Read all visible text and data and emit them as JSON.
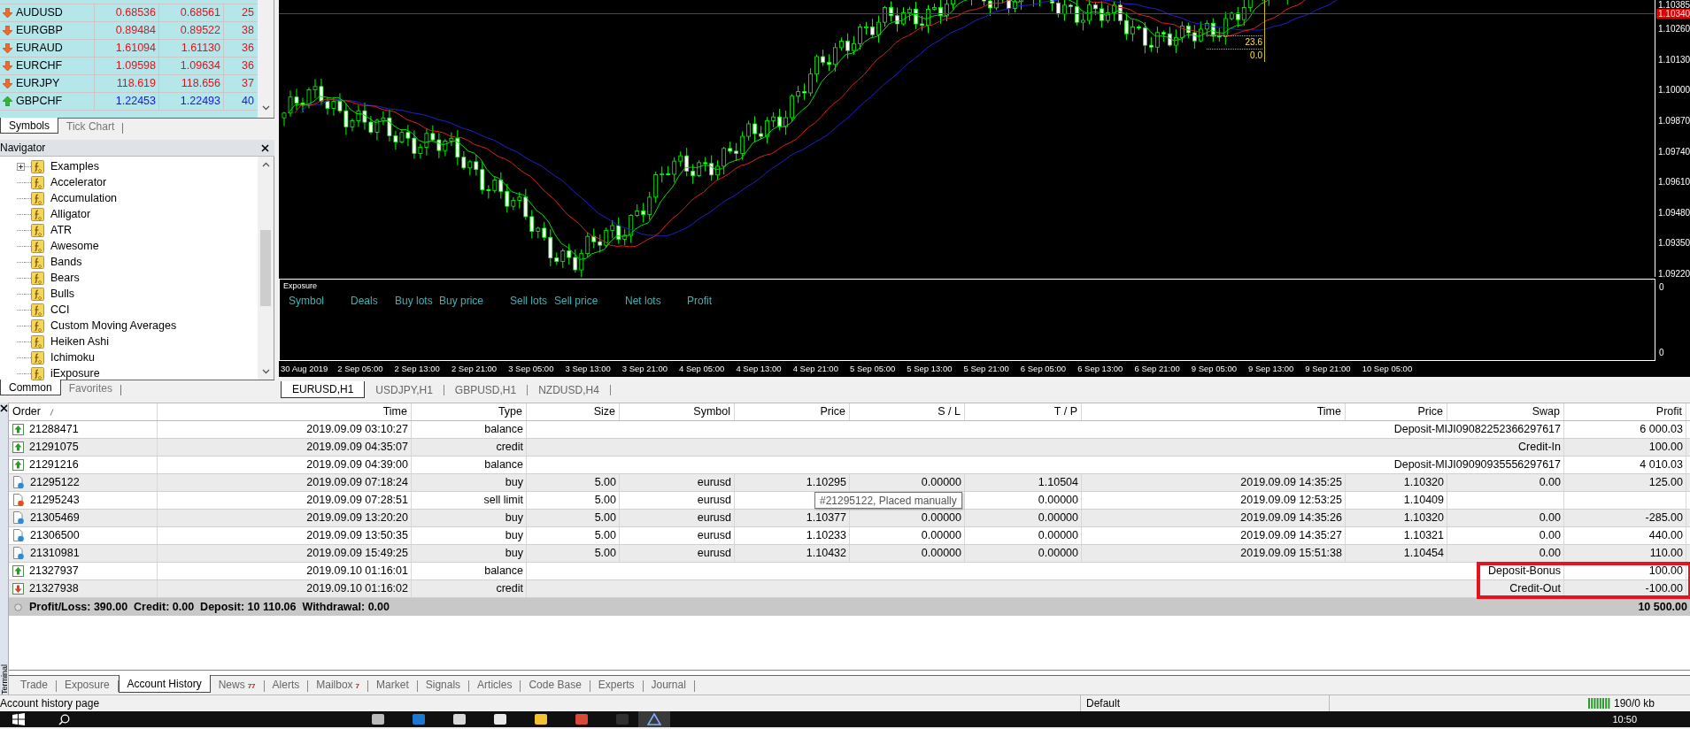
{
  "market_watch": {
    "rows": [
      {
        "symbol": "AUDUSD",
        "bid": "0.68536",
        "ask": "0.68561",
        "spread": "25",
        "rising": false
      },
      {
        "symbol": "EURGBP",
        "bid": "0.89484",
        "ask": "0.89522",
        "spread": "38",
        "rising": false
      },
      {
        "symbol": "EURAUD",
        "bid": "1.61094",
        "ask": "1.61130",
        "spread": "36",
        "rising": false
      },
      {
        "symbol": "EURCHF",
        "bid": "1.09598",
        "ask": "1.09634",
        "spread": "36",
        "rising": false
      },
      {
        "symbol": "EURJPY",
        "bid": "118.619",
        "ask": "118.656",
        "spread": "37",
        "rising": false
      },
      {
        "symbol": "GBPCHF",
        "bid": "1.22453",
        "ask": "1.22493",
        "spread": "40",
        "rising": true
      }
    ],
    "tabs": [
      {
        "label": "Symbols",
        "selected": true
      },
      {
        "label": "Tick Chart",
        "selected": false
      }
    ]
  },
  "navigator": {
    "title": "Navigator",
    "items": [
      {
        "label": "Examples",
        "expandable": true
      },
      {
        "label": "Accelerator",
        "expandable": false
      },
      {
        "label": "Accumulation",
        "expandable": false
      },
      {
        "label": "Alligator",
        "expandable": false
      },
      {
        "label": "ATR",
        "expandable": false
      },
      {
        "label": "Awesome",
        "expandable": false
      },
      {
        "label": "Bands",
        "expandable": false
      },
      {
        "label": "Bears",
        "expandable": false
      },
      {
        "label": "Bulls",
        "expandable": false
      },
      {
        "label": "CCI",
        "expandable": false
      },
      {
        "label": "Custom Moving Averages",
        "expandable": false
      },
      {
        "label": "Heiken Ashi",
        "expandable": false
      },
      {
        "label": "Ichimoku",
        "expandable": false
      },
      {
        "label": "iExposure",
        "expandable": false
      }
    ],
    "tabs": [
      {
        "label": "Common",
        "selected": true
      },
      {
        "label": "Favorites",
        "selected": false
      }
    ]
  },
  "chart": {
    "price_labels": [
      "1.10385",
      "1.10260",
      "1.10130",
      "1.10000",
      "1.09870",
      "1.09740",
      "1.09610",
      "1.09480",
      "1.09350",
      "1.09220"
    ],
    "current_price": "1.10340",
    "fib_labels": [
      "23.6",
      "0.0"
    ],
    "indicator": {
      "title": "Exposure",
      "columns": [
        "Symbol",
        "Deals",
        "Buy lots",
        "Buy price",
        "Sell lots",
        "Sell price",
        "Net lots",
        "Profit"
      ],
      "scale_labels": [
        "0",
        "0"
      ]
    },
    "time_labels": [
      "30 Aug 2019",
      "2 Sep 05:00",
      "2 Sep 13:00",
      "2 Sep 21:00",
      "3 Sep 05:00",
      "3 Sep 13:00",
      "3 Sep 21:00",
      "4 Sep 05:00",
      "4 Sep 13:00",
      "4 Sep 21:00",
      "5 Sep 05:00",
      "5 Sep 13:00",
      "5 Sep 21:00",
      "6 Sep 05:00",
      "6 Sep 13:00",
      "6 Sep 21:00",
      "9 Sep 05:00",
      "9 Sep 13:00",
      "9 Sep 21:00",
      "10 Sep 05:00"
    ],
    "tabs": [
      {
        "label": "EURUSD,H1",
        "selected": true
      },
      {
        "label": "USDJPY,H1",
        "selected": false
      },
      {
        "label": "GBPUSD,H1",
        "selected": false
      },
      {
        "label": "NZDUSD,H4",
        "selected": false
      }
    ]
  },
  "terminal": {
    "title": "Terminal",
    "columns": [
      "Order",
      "Time",
      "Type",
      "Size",
      "Symbol",
      "Price",
      "S / L",
      "T / P",
      "Time",
      "Price",
      "Swap",
      "Profit"
    ],
    "rows": [
      {
        "kind": "balance",
        "outflow": false,
        "order": "21288471",
        "time": "2019.09.09 03:10:27",
        "type": "balance",
        "comment": "Deposit-MIJI09082252366297617",
        "profit": "6 000.03"
      },
      {
        "kind": "balance",
        "outflow": false,
        "order": "21291075",
        "time": "2019.09.09 04:35:07",
        "type": "credit",
        "comment": "Credit-In",
        "profit": "100.00"
      },
      {
        "kind": "balance",
        "outflow": false,
        "order": "21291216",
        "time": "2019.09.09 04:39:00",
        "type": "balance",
        "comment": "Deposit-MIJI09090935556297617",
        "profit": "4 010.03"
      },
      {
        "kind": "trade",
        "pending": false,
        "order": "21295122",
        "time": "2019.09.09 07:18:24",
        "type": "buy",
        "size": "5.00",
        "symbol": "eurusd",
        "price": "1.10295",
        "sl": "0.00000",
        "tp": "1.10504",
        "close_time": "2019.09.09 14:35:25",
        "close_price": "1.10320",
        "swap": "0.00",
        "profit": "125.00"
      },
      {
        "kind": "trade",
        "pending": true,
        "order": "21295243",
        "time": "2019.09.09 07:28:51",
        "type": "sell limit",
        "size": "5.00",
        "symbol": "eurusd",
        "tp": "0.00000",
        "close_time": "2019.09.09 12:53:25",
        "close_price": "1.10409"
      },
      {
        "kind": "trade",
        "pending": false,
        "order": "21305469",
        "time": "2019.09.09 13:20:20",
        "type": "buy",
        "size": "5.00",
        "symbol": "eurusd",
        "price": "1.10377",
        "sl": "0.00000",
        "tp": "0.00000",
        "close_time": "2019.09.09 14:35:26",
        "close_price": "1.10320",
        "swap": "0.00",
        "profit": "-285.00"
      },
      {
        "kind": "trade",
        "pending": false,
        "order": "21306500",
        "time": "2019.09.09 13:50:35",
        "type": "buy",
        "size": "5.00",
        "symbol": "eurusd",
        "price": "1.10233",
        "sl": "0.00000",
        "tp": "0.00000",
        "close_time": "2019.09.09 14:35:27",
        "close_price": "1.10321",
        "swap": "0.00",
        "profit": "440.00"
      },
      {
        "kind": "trade",
        "pending": false,
        "order": "21310981",
        "time": "2019.09.09 15:49:25",
        "type": "buy",
        "size": "5.00",
        "symbol": "eurusd",
        "price": "1.10432",
        "sl": "0.00000",
        "tp": "0.00000",
        "close_time": "2019.09.09 15:51:38",
        "close_price": "1.10454",
        "swap": "0.00",
        "profit": "110.00"
      },
      {
        "kind": "balance",
        "outflow": false,
        "order": "21327937",
        "time": "2019.09.10 01:16:01",
        "type": "balance",
        "comment": "Deposit-Bonus",
        "profit": "100.00"
      },
      {
        "kind": "balance",
        "outflow": true,
        "order": "21327938",
        "time": "2019.09.10 01:16:02",
        "type": "credit",
        "comment": "Credit-Out",
        "profit": "-100.00"
      }
    ],
    "summary": {
      "text": "Profit/Loss: 390.00  Credit: 0.00  Deposit: 10 110.06  Withdrawal: 0.00",
      "total": "10 500.00"
    },
    "tooltip": "#21295122, Placed manually",
    "highlight": true,
    "tabs": [
      {
        "label": "Trade",
        "selected": false
      },
      {
        "label": "Exposure",
        "selected": false
      },
      {
        "label": "Account History",
        "selected": true
      },
      {
        "label": "News",
        "selected": false,
        "badge": "77"
      },
      {
        "label": "Alerts",
        "selected": false
      },
      {
        "label": "Mailbox",
        "selected": false,
        "badge": "7"
      },
      {
        "label": "Market",
        "selected": false
      },
      {
        "label": "Signals",
        "selected": false
      },
      {
        "label": "Articles",
        "selected": false
      },
      {
        "label": "Code Base",
        "selected": false
      },
      {
        "label": "Experts",
        "selected": false
      },
      {
        "label": "Journal",
        "selected": false
      }
    ]
  },
  "status_bar": {
    "message": "Account history page",
    "profile": "Default",
    "traffic": "190/0 kb"
  },
  "taskbar": {
    "clock": "10:50"
  }
}
